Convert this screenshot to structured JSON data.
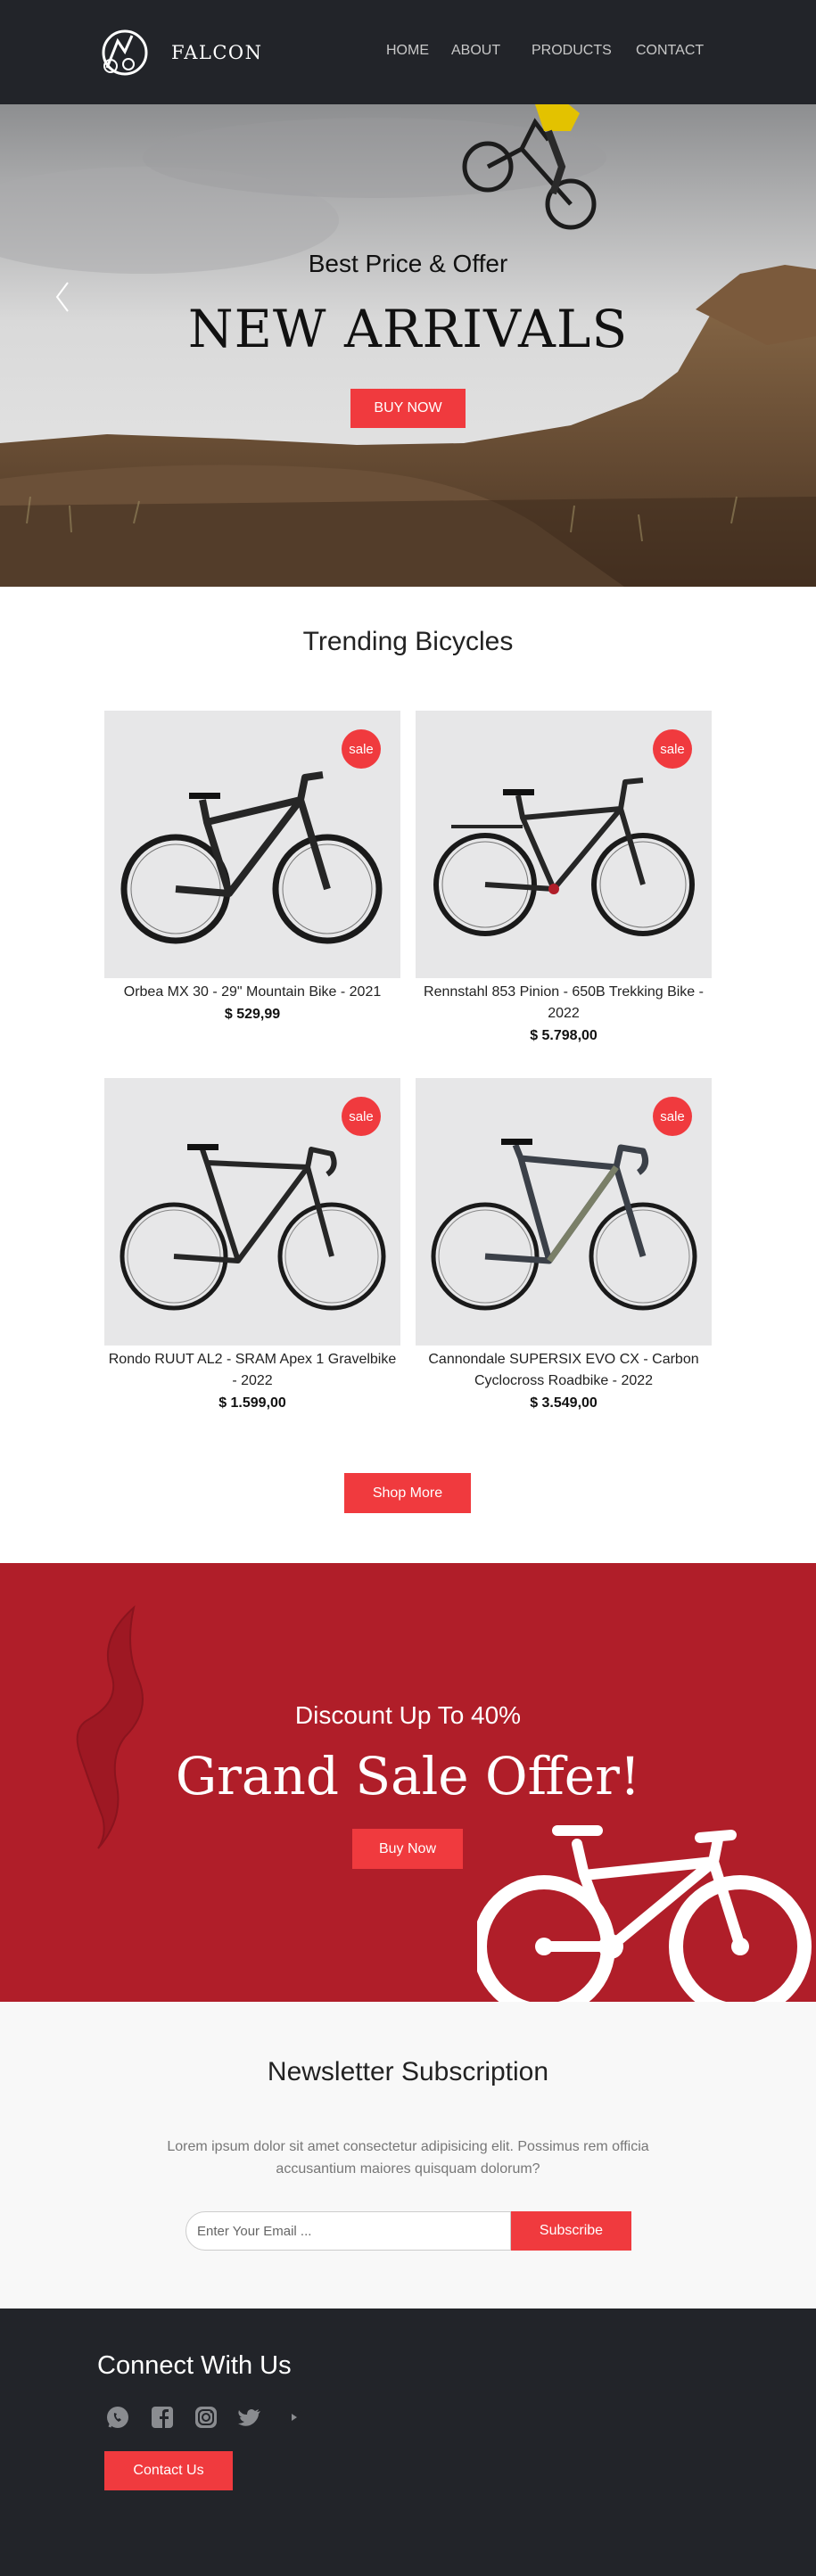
{
  "header": {
    "brand": "FALCON",
    "nav": [
      "HOME",
      "ABOUT",
      "PRODUCTS",
      "CONTACT"
    ]
  },
  "hero": {
    "subtitle": "Best Price & Offer",
    "title": "NEW ARRIVALS",
    "button": "BUY NOW"
  },
  "trending": {
    "title": "Trending Bicycles",
    "badge": "sale",
    "products": [
      {
        "name": "Orbea MX 30 - 29\" Mountain Bike - 2021",
        "price": "$ 529,99"
      },
      {
        "name": "Rennstahl 853 Pinion - 650B Trekking Bike - 2022",
        "price": "$ 5.798,00"
      },
      {
        "name": "Rondo RUUT AL2 - SRAM Apex 1 Gravelbike - 2022",
        "price": "$ 1.599,00"
      },
      {
        "name": "Cannondale SUPERSIX EVO CX - Carbon Cyclocross Roadbike - 2022",
        "price": "$ 3.549,00"
      }
    ],
    "shop_more": "Shop More"
  },
  "sale_banner": {
    "subtitle": "Discount Up To 40%",
    "title": "Grand Sale Offer!",
    "button": "Buy Now"
  },
  "newsletter": {
    "title": "Newsletter Subscription",
    "text": "Lorem ipsum dolor sit amet consectetur adipisicing elit. Possimus rem officia accusantium maiores quisquam dolorum?",
    "placeholder": "Enter Your Email ...",
    "button": "Subscribe"
  },
  "footer": {
    "title": "Connect With Us",
    "socials": [
      "whatsapp-icon",
      "facebook-icon",
      "instagram-icon",
      "twitter-icon",
      "youtube-icon"
    ],
    "button": "Contact Us"
  },
  "colors": {
    "dark": "#222429",
    "accent": "#f03a3e",
    "banner": "#b01e29"
  }
}
